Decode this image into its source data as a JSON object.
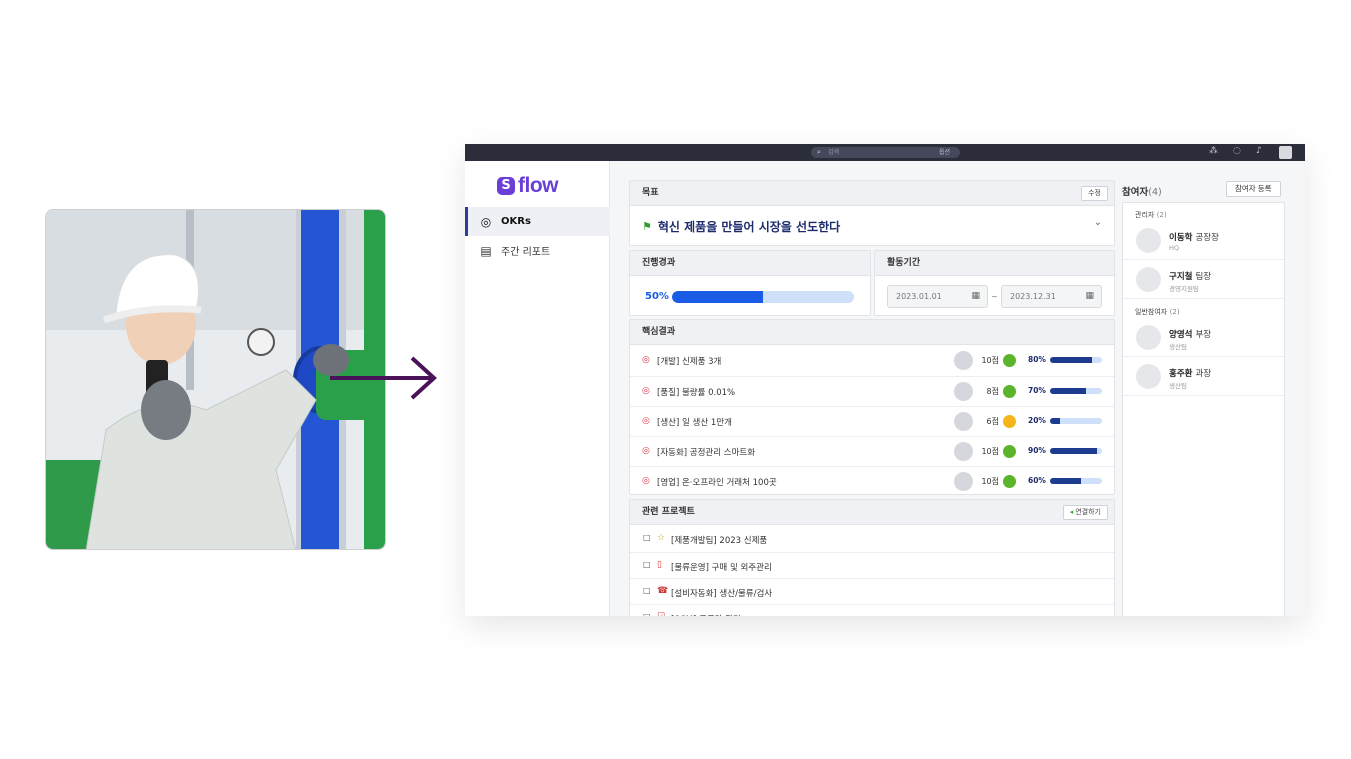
{
  "topbar": {
    "search_placeholder": "검색",
    "search_scope": "옵션"
  },
  "sidebar": {
    "logo": "flow",
    "items": [
      {
        "label": "OKRs",
        "icon": "target-icon",
        "active": true
      },
      {
        "label": "주간 리포트",
        "icon": "report-icon",
        "active": false
      }
    ]
  },
  "goal": {
    "header": "목표",
    "edit_label": "수정",
    "title": "혁신 제품을 만들어 시장을 선도한다"
  },
  "progress": {
    "header": "진행경과",
    "percent_label": "50%",
    "percent": 50
  },
  "period": {
    "header": "활동기간",
    "start": "2023.01.01",
    "end": "2023.12.31",
    "separator": "~"
  },
  "key_results": {
    "header": "핵심결과",
    "items": [
      {
        "title": "[개발] 신제품 3개",
        "score": "10점",
        "status_color": "#5bb52a",
        "percent_label": "80%",
        "percent": 80
      },
      {
        "title": "[품질] 불량률 0.01%",
        "score": "8점",
        "status_color": "#5bb52a",
        "percent_label": "70%",
        "percent": 70
      },
      {
        "title": "[생산] 일 생산 1만개",
        "score": "6점",
        "status_color": "#f5b41a",
        "percent_label": "20%",
        "percent": 20
      },
      {
        "title": "[자동화] 공정관리 스마트화",
        "score": "10점",
        "status_color": "#5bb52a",
        "percent_label": "90%",
        "percent": 90
      },
      {
        "title": "[영업] 온·오프라인 거래처 100곳",
        "score": "10점",
        "status_color": "#5bb52a",
        "percent_label": "60%",
        "percent": 60
      }
    ]
  },
  "projects": {
    "header": "관련 프로젝트",
    "connect_label": "연결하기",
    "items": [
      {
        "title": "[제품개발팀] 2023 신제품",
        "icon": "star-icon"
      },
      {
        "title": "[물류운영] 구매 및 외주관리",
        "icon": "document-icon"
      },
      {
        "title": "[설비자동화] 생산/물류/검사",
        "icon": "phone-icon"
      },
      {
        "title": "[SCM] 공급망 관리",
        "icon": "checklist-icon"
      }
    ]
  },
  "participants": {
    "header": "참여자",
    "count": "(4)",
    "register_label": "참여자 등록",
    "managers_label": "관리자",
    "managers_count": "(2)",
    "members_label": "일반참여자",
    "members_count": "(2)",
    "managers": [
      {
        "name": "이동학",
        "title": "공장장",
        "dept": "HQ"
      },
      {
        "name": "구지철",
        "title": "팀장",
        "dept": "경영지원팀"
      }
    ],
    "members": [
      {
        "name": "양영석",
        "title": "부장",
        "dept": "생산팀"
      },
      {
        "name": "홍주환",
        "title": "과장",
        "dept": "생산팀"
      }
    ]
  },
  "colors": {
    "brand": "#6a3fd8",
    "primary": "#1a5ce6",
    "navy": "#1d2b6d",
    "arrow": "#4a1259"
  }
}
